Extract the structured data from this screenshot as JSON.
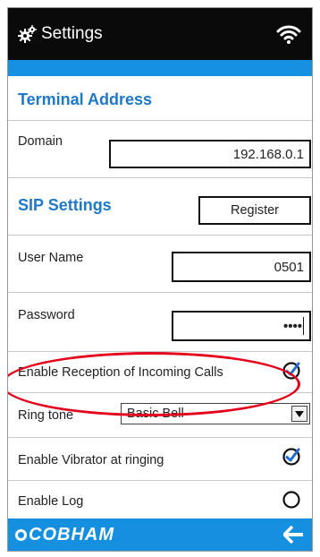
{
  "header": {
    "title": "Settings",
    "gear_icon": "gear-icon",
    "status_icon": "wifi-icon"
  },
  "terminal": {
    "section_title": "Terminal Address",
    "domain_label": "Domain",
    "domain_value": "192.168.0.1"
  },
  "sip": {
    "section_title": "SIP Settings",
    "register_label": "Register",
    "username_label": "User Name",
    "username_value": "0501",
    "password_label": "Password",
    "password_value": "••••"
  },
  "options": {
    "incoming_label": "Enable Reception of Incoming Calls",
    "incoming_checked": true,
    "ringtone_label": "Ring tone",
    "ringtone_value": "Basic Bell",
    "vibrator_label": "Enable Vibrator at ringing",
    "vibrator_checked": true,
    "log_label": "Enable Log",
    "log_checked": false
  },
  "footer": {
    "brand": "COBHAM",
    "back_icon": "back-arrow-icon"
  },
  "colors": {
    "accent": "#1690e0",
    "title_bar": "#0a0a0a",
    "highlight": "#e3001b",
    "section_title": "#1f78c8"
  }
}
